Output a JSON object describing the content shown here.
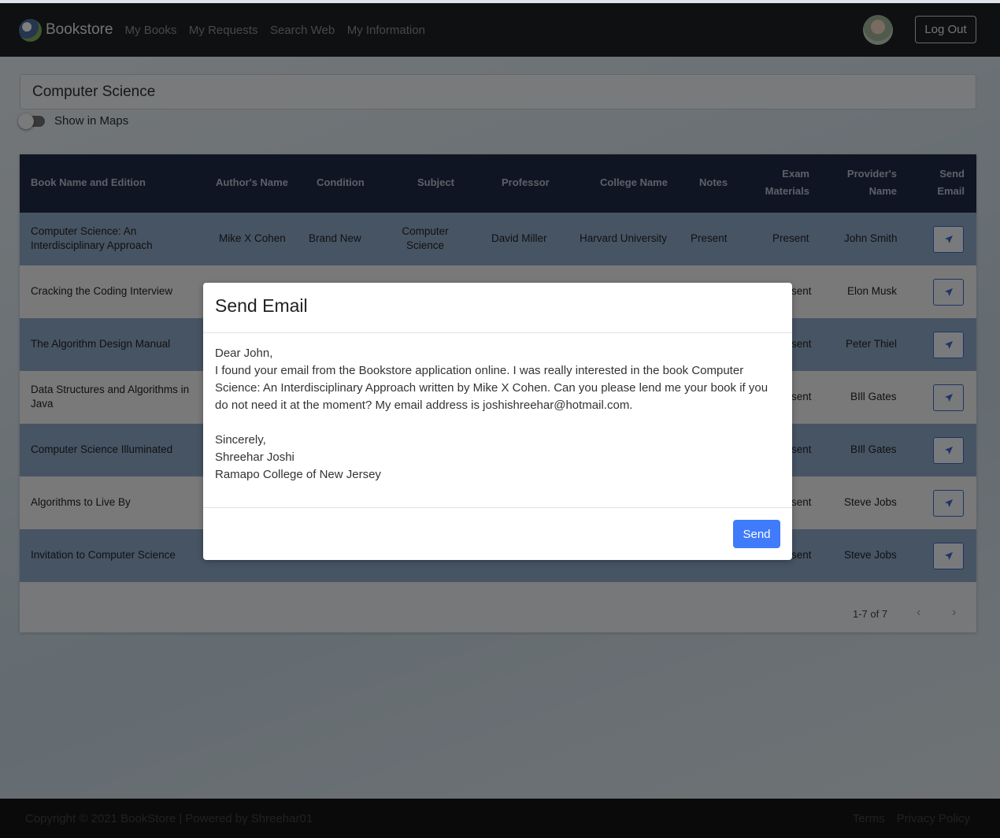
{
  "navbar": {
    "brand": "Bookstore",
    "links": [
      "My Books",
      "My Requests",
      "Search Web",
      "My Information"
    ],
    "logout": "Log Out"
  },
  "search": {
    "value": "Computer Science"
  },
  "maps_toggle": {
    "label": "Show in Maps",
    "on": false
  },
  "table": {
    "headers": [
      [
        "Book Name and Edition"
      ],
      [
        "Author's Name"
      ],
      [
        "Condition"
      ],
      [
        "Subject"
      ],
      [
        "Professor"
      ],
      [
        "College Name"
      ],
      [
        "Notes"
      ],
      [
        "Exam",
        "Materials"
      ],
      [
        "Provider's",
        "Name"
      ],
      [
        "Send",
        "Email"
      ]
    ],
    "rows": [
      {
        "book": [
          "Computer Science: An",
          "Interdisciplinary Approach"
        ],
        "author": "Mike X Cohen",
        "condition": "Brand New",
        "subject": [
          "Computer",
          "Science"
        ],
        "professor": "David Miller",
        "college": "Harvard University",
        "notes": "Present",
        "exam": "Present",
        "provider": "John Smith"
      },
      {
        "book": [
          "Cracking the Coding Interview"
        ],
        "exam": "sent",
        "provider": "Elon Musk"
      },
      {
        "book": [
          "The Algorithm Design Manual"
        ],
        "exam": "sent",
        "provider": "Peter Thiel"
      },
      {
        "book": [
          "Data Structures and Algorithms in",
          "Java"
        ],
        "exam": "sent",
        "provider": "BIll Gates"
      },
      {
        "book": [
          "Computer Science Illuminated"
        ],
        "exam": "sent",
        "provider": "BIll Gates"
      },
      {
        "book": [
          "Algorithms to Live By"
        ],
        "exam": "sent",
        "provider": "Steve Jobs"
      },
      {
        "book": [
          "Invitation to Computer Science"
        ],
        "exam": "sent",
        "provider": "Steve Jobs"
      }
    ],
    "pagination": "1-7 of 7"
  },
  "modal": {
    "title": "Send Email",
    "body": {
      "greeting": "Dear John,",
      "lines": [
        "I found your email from the Bookstore application online. I was really interested in the book Computer",
        "Science: An Interdisciplinary Approach written by Mike X Cohen. Can you please lend me your book if you",
        "do not need it at the moment? My email address is joshishreehar@hotmail.com."
      ],
      "closing": "Sincerely,",
      "name": "Shreehar Joshi",
      "college": "Ramapo College of New Jersey"
    },
    "send_label": "Send"
  },
  "footer": {
    "copyright": "Copyright © 2021 BookStore | Powered by Shreehar01",
    "links": [
      "Terms",
      "Privacy Policy"
    ]
  }
}
